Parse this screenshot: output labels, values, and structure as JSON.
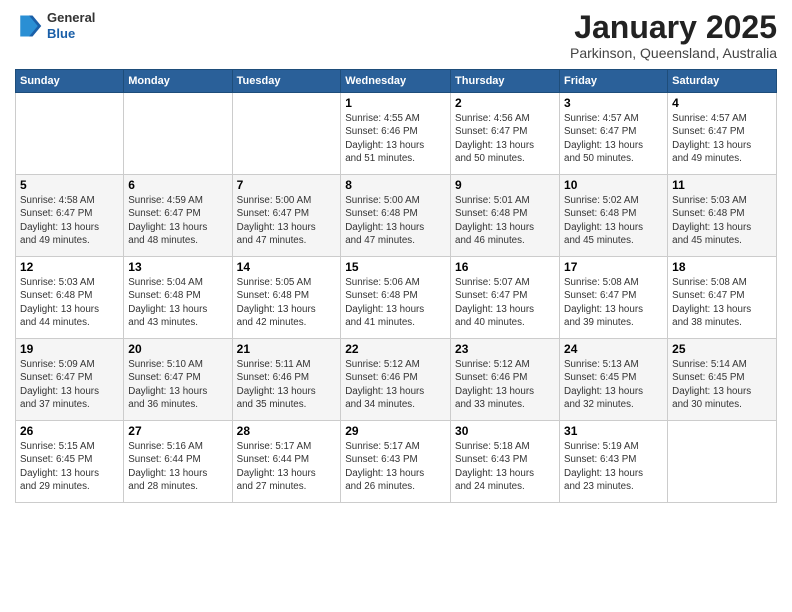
{
  "logo": {
    "general": "General",
    "blue": "Blue"
  },
  "title": "January 2025",
  "subtitle": "Parkinson, Queensland, Australia",
  "days_header": [
    "Sunday",
    "Monday",
    "Tuesday",
    "Wednesday",
    "Thursday",
    "Friday",
    "Saturday"
  ],
  "weeks": [
    [
      {
        "day": "",
        "info": ""
      },
      {
        "day": "",
        "info": ""
      },
      {
        "day": "",
        "info": ""
      },
      {
        "day": "1",
        "info": "Sunrise: 4:55 AM\nSunset: 6:46 PM\nDaylight: 13 hours\nand 51 minutes."
      },
      {
        "day": "2",
        "info": "Sunrise: 4:56 AM\nSunset: 6:47 PM\nDaylight: 13 hours\nand 50 minutes."
      },
      {
        "day": "3",
        "info": "Sunrise: 4:57 AM\nSunset: 6:47 PM\nDaylight: 13 hours\nand 50 minutes."
      },
      {
        "day": "4",
        "info": "Sunrise: 4:57 AM\nSunset: 6:47 PM\nDaylight: 13 hours\nand 49 minutes."
      }
    ],
    [
      {
        "day": "5",
        "info": "Sunrise: 4:58 AM\nSunset: 6:47 PM\nDaylight: 13 hours\nand 49 minutes."
      },
      {
        "day": "6",
        "info": "Sunrise: 4:59 AM\nSunset: 6:47 PM\nDaylight: 13 hours\nand 48 minutes."
      },
      {
        "day": "7",
        "info": "Sunrise: 5:00 AM\nSunset: 6:47 PM\nDaylight: 13 hours\nand 47 minutes."
      },
      {
        "day": "8",
        "info": "Sunrise: 5:00 AM\nSunset: 6:48 PM\nDaylight: 13 hours\nand 47 minutes."
      },
      {
        "day": "9",
        "info": "Sunrise: 5:01 AM\nSunset: 6:48 PM\nDaylight: 13 hours\nand 46 minutes."
      },
      {
        "day": "10",
        "info": "Sunrise: 5:02 AM\nSunset: 6:48 PM\nDaylight: 13 hours\nand 45 minutes."
      },
      {
        "day": "11",
        "info": "Sunrise: 5:03 AM\nSunset: 6:48 PM\nDaylight: 13 hours\nand 45 minutes."
      }
    ],
    [
      {
        "day": "12",
        "info": "Sunrise: 5:03 AM\nSunset: 6:48 PM\nDaylight: 13 hours\nand 44 minutes."
      },
      {
        "day": "13",
        "info": "Sunrise: 5:04 AM\nSunset: 6:48 PM\nDaylight: 13 hours\nand 43 minutes."
      },
      {
        "day": "14",
        "info": "Sunrise: 5:05 AM\nSunset: 6:48 PM\nDaylight: 13 hours\nand 42 minutes."
      },
      {
        "day": "15",
        "info": "Sunrise: 5:06 AM\nSunset: 6:48 PM\nDaylight: 13 hours\nand 41 minutes."
      },
      {
        "day": "16",
        "info": "Sunrise: 5:07 AM\nSunset: 6:47 PM\nDaylight: 13 hours\nand 40 minutes."
      },
      {
        "day": "17",
        "info": "Sunrise: 5:08 AM\nSunset: 6:47 PM\nDaylight: 13 hours\nand 39 minutes."
      },
      {
        "day": "18",
        "info": "Sunrise: 5:08 AM\nSunset: 6:47 PM\nDaylight: 13 hours\nand 38 minutes."
      }
    ],
    [
      {
        "day": "19",
        "info": "Sunrise: 5:09 AM\nSunset: 6:47 PM\nDaylight: 13 hours\nand 37 minutes."
      },
      {
        "day": "20",
        "info": "Sunrise: 5:10 AM\nSunset: 6:47 PM\nDaylight: 13 hours\nand 36 minutes."
      },
      {
        "day": "21",
        "info": "Sunrise: 5:11 AM\nSunset: 6:46 PM\nDaylight: 13 hours\nand 35 minutes."
      },
      {
        "day": "22",
        "info": "Sunrise: 5:12 AM\nSunset: 6:46 PM\nDaylight: 13 hours\nand 34 minutes."
      },
      {
        "day": "23",
        "info": "Sunrise: 5:12 AM\nSunset: 6:46 PM\nDaylight: 13 hours\nand 33 minutes."
      },
      {
        "day": "24",
        "info": "Sunrise: 5:13 AM\nSunset: 6:45 PM\nDaylight: 13 hours\nand 32 minutes."
      },
      {
        "day": "25",
        "info": "Sunrise: 5:14 AM\nSunset: 6:45 PM\nDaylight: 13 hours\nand 30 minutes."
      }
    ],
    [
      {
        "day": "26",
        "info": "Sunrise: 5:15 AM\nSunset: 6:45 PM\nDaylight: 13 hours\nand 29 minutes."
      },
      {
        "day": "27",
        "info": "Sunrise: 5:16 AM\nSunset: 6:44 PM\nDaylight: 13 hours\nand 28 minutes."
      },
      {
        "day": "28",
        "info": "Sunrise: 5:17 AM\nSunset: 6:44 PM\nDaylight: 13 hours\nand 27 minutes."
      },
      {
        "day": "29",
        "info": "Sunrise: 5:17 AM\nSunset: 6:43 PM\nDaylight: 13 hours\nand 26 minutes."
      },
      {
        "day": "30",
        "info": "Sunrise: 5:18 AM\nSunset: 6:43 PM\nDaylight: 13 hours\nand 24 minutes."
      },
      {
        "day": "31",
        "info": "Sunrise: 5:19 AM\nSunset: 6:43 PM\nDaylight: 13 hours\nand 23 minutes."
      },
      {
        "day": "",
        "info": ""
      }
    ]
  ]
}
